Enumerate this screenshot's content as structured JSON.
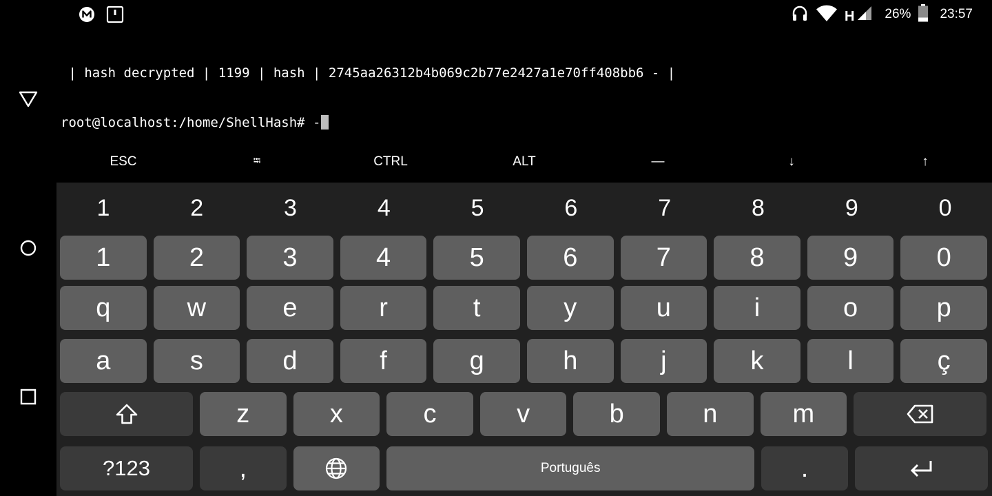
{
  "status_bar": {
    "notification_icons": [
      "mega-icon",
      "sdcard-icon"
    ],
    "network_type": "H",
    "battery_percent": "26%",
    "battery_level": 0.26,
    "time": "23:57"
  },
  "terminal": {
    "lines": [
      " | hash decrypted | 1199 | hash | 2745aa26312b4b069c2b77e2427a1e70ff408bb6 - |",
      "root@localhost:/home/ShellHash# -"
    ]
  },
  "extra_keys": [
    "ESC",
    "⭾",
    "CTRL",
    "ALT",
    "—",
    "↓",
    "↑"
  ],
  "keyboard": {
    "number_hints": [
      "1",
      "2",
      "3",
      "4",
      "5",
      "6",
      "7",
      "8",
      "9",
      "0"
    ],
    "number_row": [
      "1",
      "2",
      "3",
      "4",
      "5",
      "6",
      "7",
      "8",
      "9",
      "0"
    ],
    "row1": [
      "q",
      "w",
      "e",
      "r",
      "t",
      "y",
      "u",
      "i",
      "o",
      "p"
    ],
    "row2": [
      "a",
      "s",
      "d",
      "f",
      "g",
      "h",
      "j",
      "k",
      "l",
      "ç"
    ],
    "row3": [
      "z",
      "x",
      "c",
      "v",
      "b",
      "n",
      "m"
    ],
    "symbols_key": "?123",
    "comma_key": ",",
    "space_label": "Português",
    "period_key": "."
  },
  "colors": {
    "background": "#000000",
    "keyboard_bg": "#212121",
    "key": "#5f5f5f",
    "key_dark": "#3a3a3a",
    "cursor": "#bdbdbd"
  }
}
